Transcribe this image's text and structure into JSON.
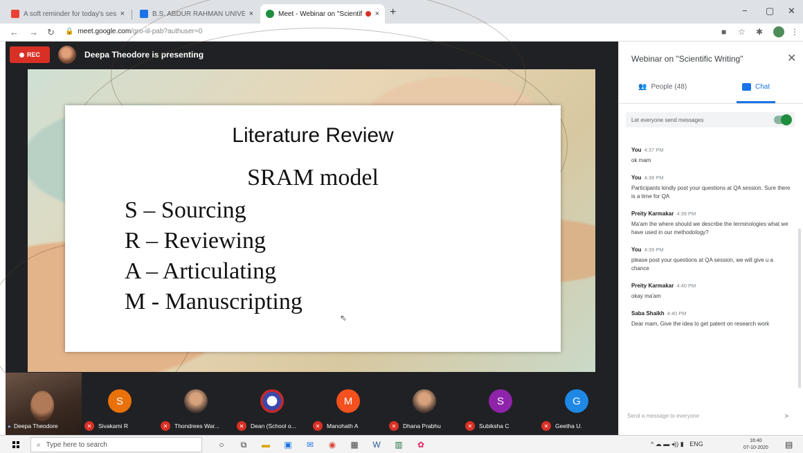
{
  "browser": {
    "tabs": [
      {
        "label": "A soft reminder for today's sess",
        "color": "#ea4335",
        "active": false
      },
      {
        "label": "B.S. ABDUR RAHMAN UNIVERSI",
        "color": "#1a73e8",
        "active": false
      },
      {
        "label": "Meet - Webinar on \"Scientific",
        "color": "#1e8e3e",
        "active": true
      }
    ],
    "close_glyph": "×",
    "new_tab": "+",
    "window_controls": [
      "−",
      "▢",
      "✕"
    ],
    "url_host": "meet.google.com",
    "url_path": "/gro-iil-pab?authuser=0"
  },
  "meet": {
    "rec_label": "REC",
    "presenting_text": "Deepa Theodore is presenting",
    "slide": {
      "title": "Literature Review",
      "subtitle": "SRAM model",
      "items": [
        "S – Sourcing",
        "R – Reviewing",
        "A – Articulating",
        "M - Manuscripting"
      ]
    },
    "participants": [
      {
        "name": "Deepa Theodore",
        "initial": "",
        "color": "",
        "self": true
      },
      {
        "name": "Sivakami R",
        "initial": "S",
        "color": "#e8710a"
      },
      {
        "name": "Thondrees War...",
        "initial": "",
        "color": "",
        "photo": true
      },
      {
        "name": "Dean (School o...",
        "initial": "",
        "color": "#3949ab",
        "photo": true
      },
      {
        "name": "Manohath A",
        "initial": "M",
        "color": "#f4511e"
      },
      {
        "name": "Dhana Prabhu",
        "initial": "",
        "color": "",
        "photo": true
      },
      {
        "name": "Subiksha C",
        "initial": "S",
        "color": "#8e24aa"
      },
      {
        "name": "Geetha U.",
        "initial": "G",
        "color": "#1e88e5"
      }
    ]
  },
  "panel": {
    "title": "Webinar on \"Scientific Writing\"",
    "people_tab": "People (48)",
    "chat_tab": "Chat",
    "permission_text": "Let everyone send messages",
    "messages": [
      {
        "sender": "You",
        "time": "4:37 PM",
        "text": "ok mam"
      },
      {
        "sender": "You",
        "time": "4:38 PM",
        "text": "Participants kindly post your questions at QA session. Sure there is a time for QA"
      },
      {
        "sender": "Preity Karmakar",
        "time": "4:39 PM",
        "text": "Ma'am the where should we describe the terminologies what we have used in our methodology?"
      },
      {
        "sender": "You",
        "time": "4:39 PM",
        "text": "please post your questions at QA session, we will give u a chance"
      },
      {
        "sender": "Preity Karmakar",
        "time": "4:40 PM",
        "text": "okay ma'am"
      },
      {
        "sender": "Saba Shaikh",
        "time": "4:40 PM",
        "text": "Dear mam, Give the idea to get patent on research work"
      }
    ],
    "send_placeholder": "Send a message to everyone"
  },
  "taskbar": {
    "search_placeholder": "Type here to search",
    "lang": "ENG",
    "time": "16:40",
    "date": "07-10-2020"
  }
}
